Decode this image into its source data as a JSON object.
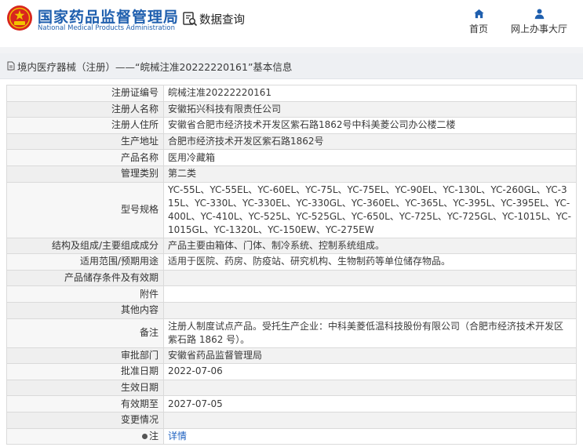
{
  "header": {
    "brand_cn": "国家药品监督管理局",
    "brand_en": "National Medical Products Administration",
    "query_label": "数据查询",
    "nav": {
      "home": "首页",
      "service": "网上办事大厅"
    }
  },
  "breadcrumb": {
    "title": "境内医疗器械（注册）——“皖械注准20222220161”基本信息"
  },
  "rows": [
    {
      "label": "注册证编号",
      "value": "皖械注准20222220161"
    },
    {
      "label": "注册人名称",
      "value": "安徽拓兴科技有限责任公司"
    },
    {
      "label": "注册人住所",
      "value": "安徽省合肥市经济技术开发区紫石路1862号中科美菱公司办公楼二楼"
    },
    {
      "label": "生产地址",
      "value": "合肥市经济技术开发区紫石路1862号"
    },
    {
      "label": "产品名称",
      "value": "医用冷藏箱"
    },
    {
      "label": "管理类别",
      "value": "第二类"
    },
    {
      "label": "型号规格",
      "value": "YC-55L、YC-55EL、YC-60EL、YC-75L、YC-75EL、YC-90EL、YC-130L、YC-260GL、YC-315L、YC-330L、YC-330EL、YC-330GL、YC-360EL、YC-365L、YC-395L、YC-395EL、YC-400L、YC-410L、YC-525L、YC-525GL、YC-650L、YC-725L、YC-725GL、YC-1015L、YC-1015GL、YC-1320L、YC-150EW、YC-275EW"
    },
    {
      "label": "结构及组成/主要组成成分",
      "value": "产品主要由箱体、门体、制冷系统、控制系统组成。"
    },
    {
      "label": "适用范围/预期用途",
      "value": "适用于医院、药房、防疫站、研究机构、生物制药等单位储存物品。"
    },
    {
      "label": "产品储存条件及有效期",
      "value": ""
    },
    {
      "label": "附件",
      "value": ""
    },
    {
      "label": "其他内容",
      "value": ""
    },
    {
      "label": "备注",
      "value": "注册人制度试点产品。受托生产企业：中科美菱低温科技股份有限公司（合肥市经济技术开发区紫石路 1862 号）。"
    },
    {
      "label": "审批部门",
      "value": "安徽省药品监督管理局"
    },
    {
      "label": "批准日期",
      "value": "2022-07-06"
    },
    {
      "label": "生效日期",
      "value": ""
    },
    {
      "label": "有效期至",
      "value": "2027-07-05"
    },
    {
      "label": "变更情况",
      "value": ""
    }
  ],
  "note": {
    "label": "注",
    "link": "详情"
  },
  "colors": {
    "brand_blue": "#1f5fae",
    "link_blue": "#1f62c0",
    "emblem_red": "#d8261e",
    "emblem_gold": "#f2c200"
  },
  "icons": [
    "emblem-logo",
    "document-search-icon",
    "home-icon",
    "user-icon",
    "document-icon"
  ]
}
